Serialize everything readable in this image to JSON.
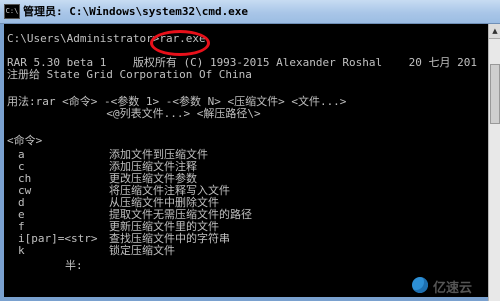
{
  "window": {
    "title": "管理员: C:\\Windows\\system32\\cmd.exe",
    "icon_label": "C:\\"
  },
  "console": {
    "prompt_line": "C:\\Users\\Administrator>rar.exe",
    "version_line": "RAR 5.30 beta 1    版权所有 (C) 1993-2015 Alexander Roshal    20 七月 201",
    "registered_line": "注册给 State Grid Corporation Of China",
    "usage_line": "用法:rar <命令> -<参数 1> -<参数 N> <压缩文件> <文件...>",
    "usage_line2": "               <@列表文件...> <解压路径\\>",
    "commands_header": "<命令>",
    "commands": [
      {
        "cmd": "a",
        "desc": "添加文件到压缩文件"
      },
      {
        "cmd": "c",
        "desc": "添加压缩文件注释"
      },
      {
        "cmd": "ch",
        "desc": "更改压缩文件参数"
      },
      {
        "cmd": "cw",
        "desc": "将压缩文件注释写入文件"
      },
      {
        "cmd": "d",
        "desc": "从压缩文件中删除文件"
      },
      {
        "cmd": "e",
        "desc": "提取文件无需压缩文件的路径"
      },
      {
        "cmd": "f",
        "desc": "更新压缩文件里的文件"
      },
      {
        "cmd": "i[par]=<str>",
        "desc": "查找压缩文件中的字符串"
      },
      {
        "cmd": "k",
        "desc": "锁定压缩文件"
      }
    ],
    "ime_status": "半:"
  },
  "annotation": {
    "ring_color": "#e8101a"
  },
  "watermark": {
    "text": "亿速云",
    "icon": "yisu-logo-icon"
  }
}
